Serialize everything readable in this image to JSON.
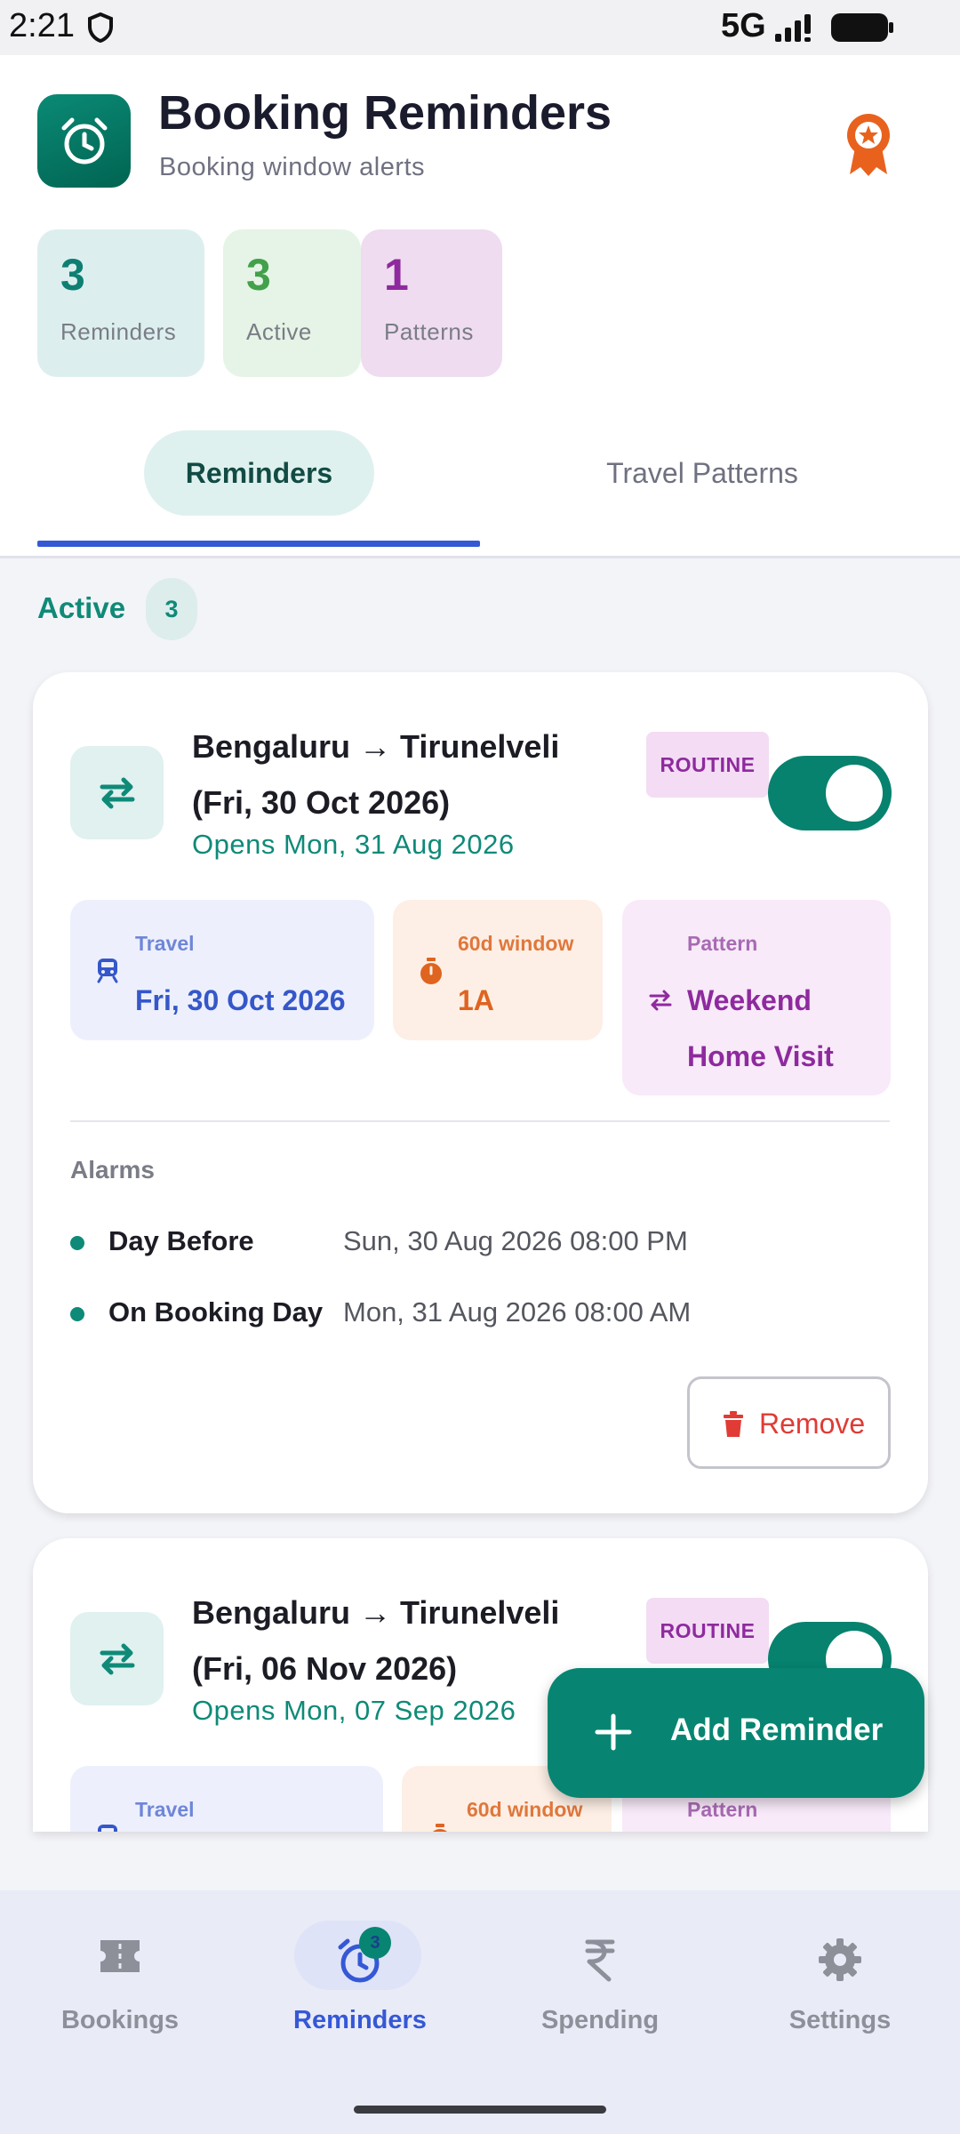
{
  "status_bar": {
    "time": "2:21",
    "network": "5G"
  },
  "header": {
    "title": "Booking Reminders",
    "subtitle": "Booking window alerts",
    "app_icon": "alarm-clock-icon",
    "award_icon": "award-icon"
  },
  "stats": [
    {
      "value": "3",
      "label": "Reminders"
    },
    {
      "value": "3",
      "label": "Active"
    },
    {
      "value": "1",
      "label": "Patterns"
    }
  ],
  "tabs": [
    {
      "label": "Reminders",
      "selected": true
    },
    {
      "label": "Travel Patterns",
      "selected": false
    }
  ],
  "section": {
    "label": "Active",
    "count": "3"
  },
  "reminders": [
    {
      "route": "Bengaluru → Tirunelveli (Fri, 30 Oct 2026)",
      "opens": "Opens Mon, 31 Aug 2026",
      "badge": "ROUTINE",
      "enabled": true,
      "travel_label": "Travel",
      "travel_value": "Fri, 30 Oct 2026",
      "window_label": "60d window",
      "window_value": "1A",
      "pattern_label": "Pattern",
      "pattern_value": "Weekend Home Visit",
      "alarms_title": "Alarms",
      "alarms": [
        {
          "name": "Day Before",
          "time": "Sun, 30 Aug 2026 08:00 PM"
        },
        {
          "name": "On Booking Day",
          "time": "Mon, 31 Aug 2026 08:00 AM"
        }
      ],
      "remove_label": "Remove"
    },
    {
      "route": "Bengaluru → Tirunelveli (Fri, 06 Nov 2026)",
      "opens": "Opens Mon, 07 Sep 2026",
      "badge": "ROUTINE",
      "enabled": true,
      "travel_label": "Travel",
      "window_label": "60d window",
      "pattern_label": "Pattern"
    }
  ],
  "fab": {
    "label": "Add Reminder"
  },
  "bottom_nav": [
    {
      "label": "Bookings",
      "icon": "ticket-icon",
      "active": false
    },
    {
      "label": "Reminders",
      "icon": "alarm-icon",
      "active": true,
      "badge": "3"
    },
    {
      "label": "Spending",
      "icon": "rupee-icon",
      "active": false
    },
    {
      "label": "Settings",
      "icon": "gear-icon",
      "active": false
    }
  ],
  "colors": {
    "primary": "#078572",
    "accent_blue": "#3558d6",
    "pattern_purple": "#8e2a9e",
    "window_orange": "#df6420",
    "danger": "#e03b35"
  }
}
